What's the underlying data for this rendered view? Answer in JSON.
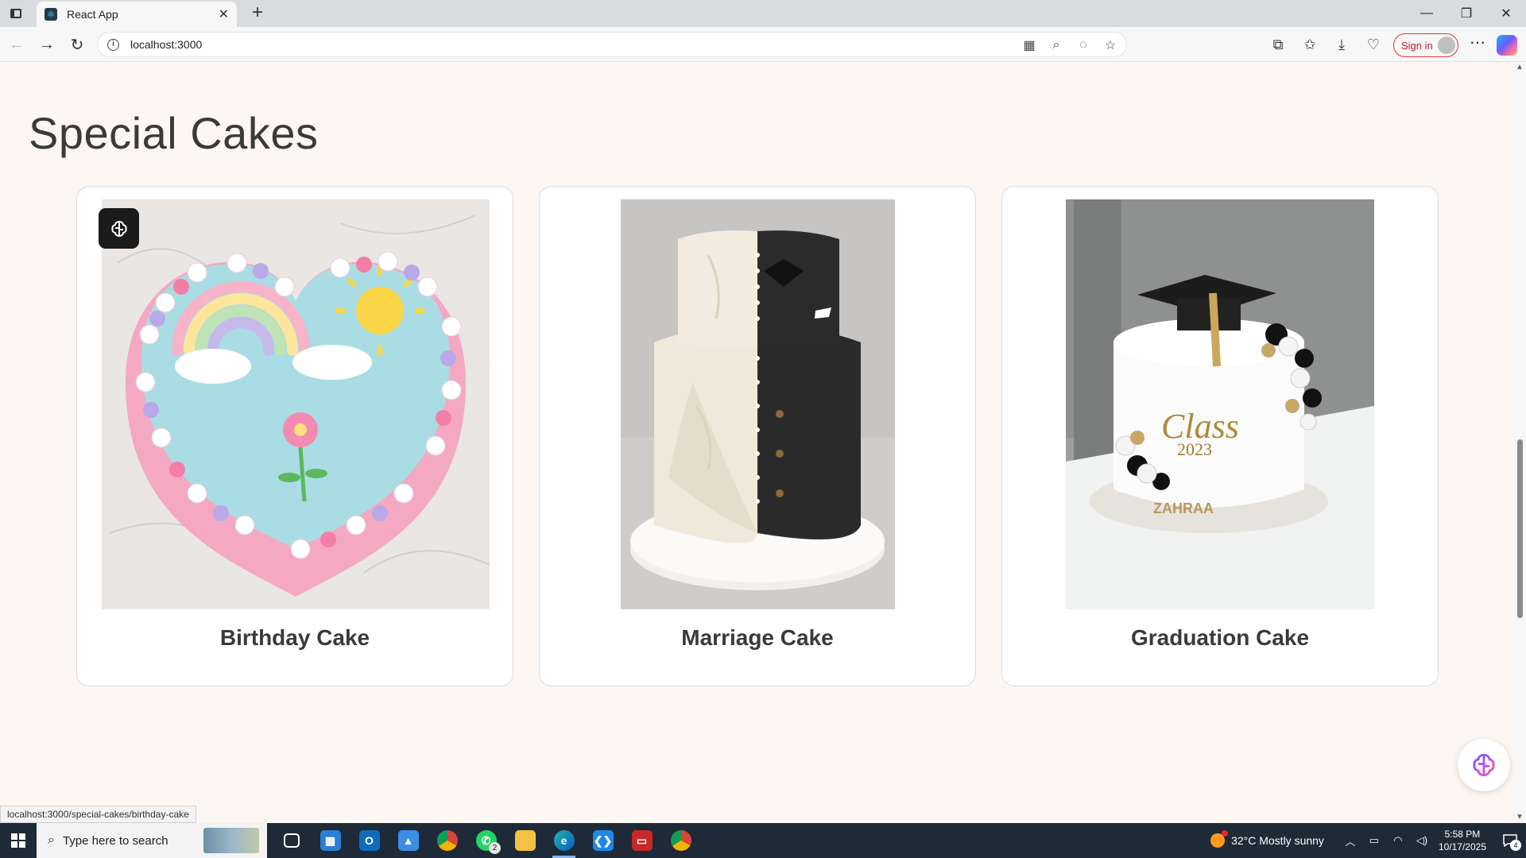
{
  "browser": {
    "tab_title": "React App",
    "url": "localhost:3000",
    "signin_label": "Sign in"
  },
  "page": {
    "section_title": "Special Cakes",
    "cards": [
      {
        "title": "Birthday Cake",
        "image": "heart-shaped rainbow birthday cake"
      },
      {
        "title": "Marriage Cake",
        "image": "half-dress half-tuxedo wedding cake"
      },
      {
        "title": "Graduation Cake",
        "image": "graduation cap cake Class 2023"
      }
    ],
    "graduation_cake_text": {
      "line1": "Class",
      "line2": "2023",
      "base": "ZAHRAA"
    },
    "status_url": "localhost:3000/special-cakes/birthday-cake"
  },
  "taskbar": {
    "search_placeholder": "Type here to search",
    "whatsapp_badge": "2",
    "weather": "32°C  Mostly sunny",
    "time": "5:58 PM",
    "date": "10/17/2025",
    "notification_count": "4"
  },
  "colors": {
    "page_bg": "#fdf7f3",
    "signin_accent": "#d33333",
    "taskbar_bg": "#1e2a38"
  }
}
